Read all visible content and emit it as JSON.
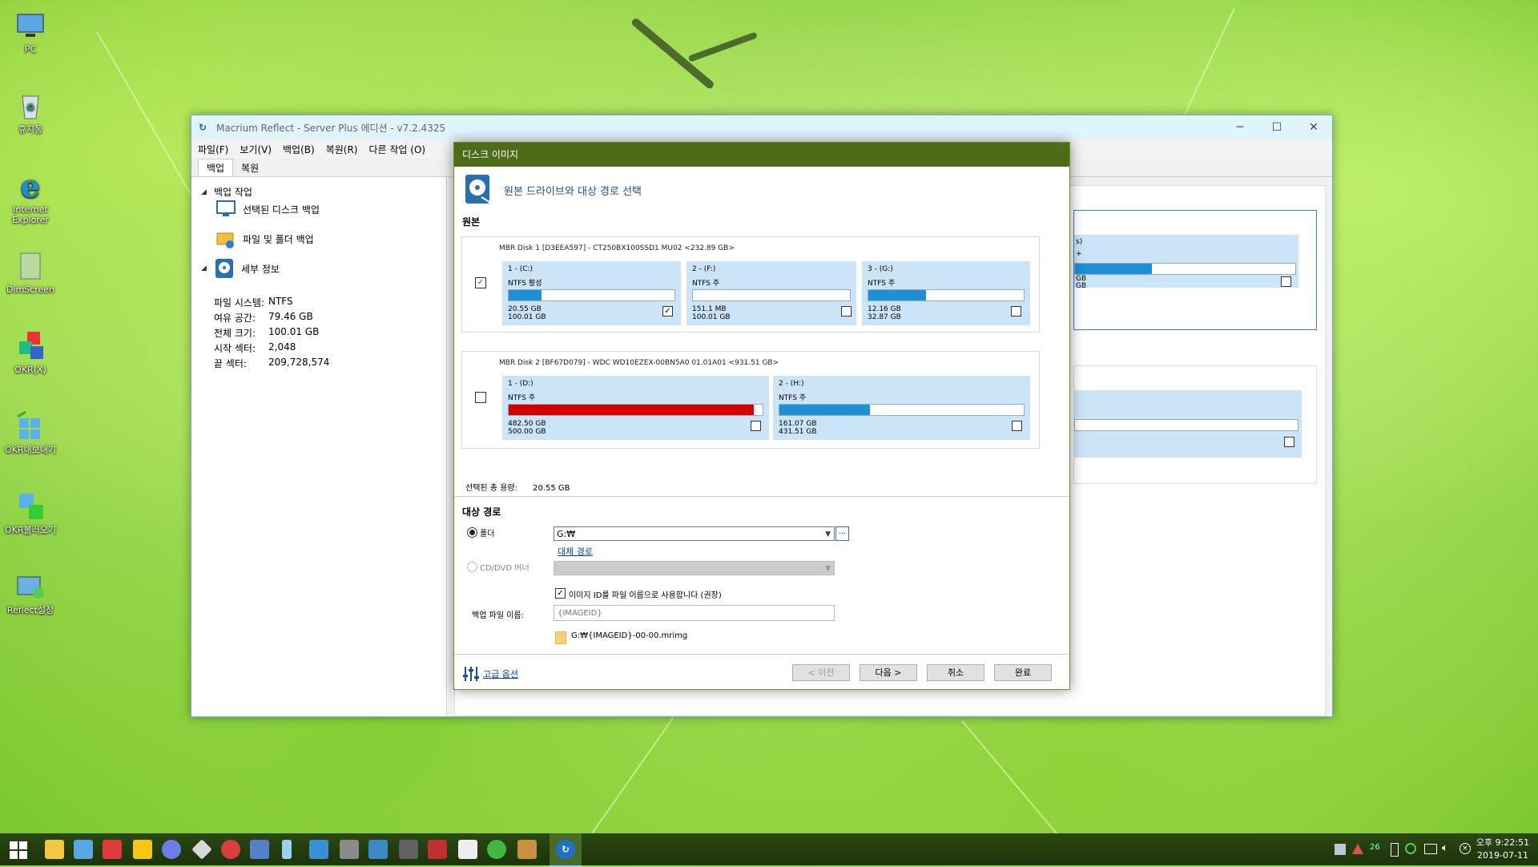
{
  "desktop": {
    "icons": [
      {
        "label": "PC",
        "icon": "computer-icon"
      },
      {
        "label": "휴지통",
        "icon": "recycle-bin-icon"
      },
      {
        "label": "Internet\nExplorer",
        "icon": "ie-icon"
      },
      {
        "label": "DimScreen",
        "icon": "dimscreen-icon"
      },
      {
        "label": "OKR(X)",
        "icon": "okr-icon"
      },
      {
        "label": "OKR내보내기",
        "icon": "okr-export-icon"
      },
      {
        "label": "OKR불러오기",
        "icon": "okr-import-icon"
      },
      {
        "label": "Reflect설정",
        "icon": "reflect-settings-icon"
      }
    ]
  },
  "mainwin": {
    "title": "Macrium Reflect - Server Plus 에디션 - v7.2.4325",
    "menu": [
      "파일(F)",
      "보기(V)",
      "백업(B)",
      "복원(R)",
      "다른 작업 (O)"
    ],
    "tabs": [
      "백업",
      "복원"
    ],
    "tree": {
      "backup_tasks": "백업 작업",
      "disk_backup": "선택된 디스크 백업",
      "file_backup": "파일 및 폴더 백업",
      "details": "세부 정보"
    },
    "info": [
      {
        "k": "파일 시스템:",
        "v": "NTFS"
      },
      {
        "k": "여유 공간:",
        "v": "79.46 GB"
      },
      {
        "k": "전체 크기:",
        "v": "100.01 GB"
      },
      {
        "k": "시작 섹터:",
        "v": "2,048"
      },
      {
        "k": "끝 섹터:",
        "v": "209,728,574"
      }
    ],
    "bg_partition": {
      "label": "s)",
      "fs": "+",
      "size1": "GB",
      "size2": "GB",
      "fill": 0.35
    }
  },
  "dialog": {
    "title": "디스크 이미지",
    "header": "원본 드라이브와 대상 경로 선택",
    "source_label": "원본",
    "disk1": {
      "title": "MBR Disk 1 [D3EEA597] - CT250BX100SSD1 MU02  <232.89 GB>",
      "checked": true,
      "partitions": [
        {
          "name": "1 - (C:)",
          "fs": "NTFS 활성",
          "used": "20.55 GB",
          "total": "100.01 GB",
          "fill": 0.2,
          "color": "#1e90d6",
          "checked": true
        },
        {
          "name": "2 - (F:)",
          "fs": "NTFS 주",
          "used": "151.1 MB",
          "total": "100.01 GB",
          "fill": 0.0,
          "color": "#1e90d6",
          "checked": false
        },
        {
          "name": "3 - (G:)",
          "fs": "NTFS 주",
          "used": "12.16 GB",
          "total": "32.87 GB",
          "fill": 0.37,
          "color": "#1e90d6",
          "checked": false
        }
      ]
    },
    "disk2": {
      "title": "MBR Disk 2 [BF67D079] - WDC WD10EZEX-00BN5A0 01.01A01  <931.51 GB>",
      "checked": false,
      "partitions": [
        {
          "name": "1 - (D:)",
          "fs": "NTFS 주",
          "used": "482.50 GB",
          "total": "500.00 GB",
          "fill": 0.965,
          "color": "#d40000",
          "checked": false
        },
        {
          "name": "2 - (H:)",
          "fs": "NTFS 주",
          "used": "161.07 GB",
          "total": "431.51 GB",
          "fill": 0.37,
          "color": "#1e90d6",
          "checked": false
        }
      ]
    },
    "selected_total_label": "선택된 총 용량:",
    "selected_total_value": "20.55 GB",
    "dest_label": "대상 경로",
    "folder_label": "폴더",
    "folder_value": "G:₩",
    "browse_label": "...",
    "alt_path_link": "대체 경로",
    "cd_label": "CD/DVD 버너",
    "use_id_label": "이미지 ID를 파일 이름으로 사용합니다 (권장)",
    "filename_label": "백업 파일 이름:",
    "filename_value": "{IMAGEID}",
    "output_path": "G:₩{IMAGEID}-00-00.mrimg",
    "advanced_link": "고급 옵션",
    "buttons": {
      "prev": "< 이전",
      "next": "다음 >",
      "cancel": "취소",
      "finish": "완료"
    }
  },
  "taskbar": {
    "time": "오후 9:22:51",
    "date": "2019-07-11",
    "tray_badge": "26"
  }
}
